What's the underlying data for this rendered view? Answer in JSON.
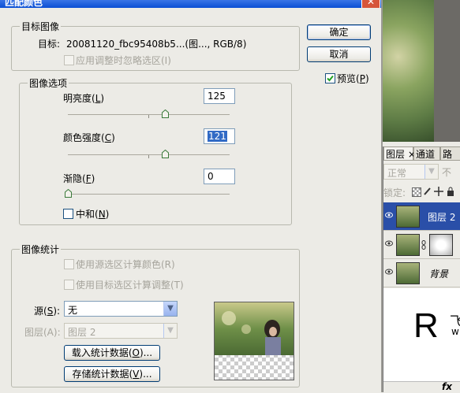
{
  "dialog": {
    "title": "匹配颜色",
    "close_glyph": "✕",
    "ok_label": "确定",
    "cancel_label": "取消",
    "preview_label": "预览(",
    "preview_key": "P",
    "preview_close": ")",
    "preview_checked": true
  },
  "target_image": {
    "legend": "目标图像",
    "target_label": "目标:",
    "target_value": "20081120_fbc95408b5...(图..., RGB/8)",
    "ignore_selection_label": "应用调整时忽略选区(I)"
  },
  "image_options": {
    "legend": "图像选项",
    "luminance_label": "明亮度(",
    "luminance_key": "L",
    "luminance_value": "125",
    "luminance_level": 0.6,
    "color_intensity_label": "颜色强度(",
    "color_intensity_key": "C",
    "color_intensity_value": "121",
    "color_intensity_level": 0.6,
    "fade_label": "渐隐(",
    "fade_key": "F",
    "fade_value": "0",
    "fade_level": 0,
    "neutralize_label": "中和(",
    "neutralize_key": "N",
    "neutralize_checked": false
  },
  "image_statistics": {
    "legend": "图像统计",
    "use_selection_source_label": "使用源选区计算颜色(R)",
    "use_selection_target_label": "使用目标选区计算调整(T)",
    "source_label": "源(",
    "source_key": "S",
    "source_value": "无",
    "layer_label": "图层(A):",
    "layer_value": "图层 2",
    "load_stats_label": "载入统计数据(",
    "load_stats_key": "O",
    "save_stats_label": "存储统计数据(",
    "save_stats_key": "V",
    "ellipsis_suffix": ")..."
  },
  "layers_panel": {
    "tabs": [
      "图层 ×",
      "通道",
      "路"
    ],
    "blend_mode": "正常",
    "opacity_label_partial": "不",
    "lock_label": "锁定:",
    "layers": [
      {
        "name": "图层 2",
        "selected": true
      },
      {
        "name": "",
        "selected": false
      },
      {
        "name": "背景",
        "selected": false
      }
    ],
    "bottom_label": "fx"
  },
  "watermark": {
    "letter": "R",
    "text1": "飞",
    "text2": "w"
  },
  "colors": {
    "selection_blue": "#2a4fa8",
    "title_blue": "#0a4fd4"
  }
}
